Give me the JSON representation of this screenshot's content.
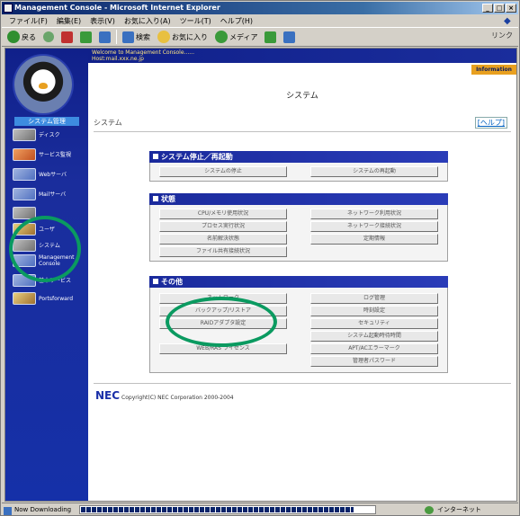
{
  "window": {
    "title": "Management Console - Microsoft Internet Explorer",
    "controls": [
      "_",
      "□",
      "×"
    ]
  },
  "menubar": {
    "items": [
      "ファイル(F)",
      "編集(E)",
      "表示(V)",
      "お気に入り(A)",
      "ツール(T)",
      "ヘルプ(H)"
    ]
  },
  "toolbar": {
    "back": "戻る",
    "search": "検索",
    "favorites": "お気に入り",
    "media": "メディア",
    "links": "リンク"
  },
  "sidebar": {
    "active_label": "システム管理",
    "items": [
      {
        "label": "ディスク",
        "icon": "disk-icon"
      },
      {
        "label": "サービス監視",
        "icon": "service-icon"
      },
      {
        "label": "Webサーバ",
        "icon": "web-server-icon"
      },
      {
        "label": "Mailサーバ",
        "icon": "mail-server-icon"
      },
      {
        "label": "",
        "icon": "dns-icon"
      },
      {
        "label": "ユーザ",
        "icon": "user-icon"
      },
      {
        "label": "システム",
        "icon": "system-icon"
      },
      {
        "label": "Management Console",
        "icon": "management-console-icon"
      },
      {
        "label": "基本サービス",
        "icon": "basic-service-icon"
      },
      {
        "label": "Portsforward",
        "icon": "portsforward-icon"
      }
    ]
  },
  "header": {
    "welcome": "Welcome to Management Console......",
    "host": "Host:mail.xxx.ne.jp",
    "info_badge": "Information"
  },
  "page": {
    "heading": "システム",
    "crumb": "システム",
    "help": "[ヘルプ]"
  },
  "sections": {
    "stop_restart": {
      "title": "システム停止／再起動",
      "buttons": [
        "システムの停止",
        "システムの再起動"
      ]
    },
    "status": {
      "title": "状態",
      "buttons": [
        "CPU/メモリ使用状況",
        "ネットワーク利用状況",
        "プロセス実行状況",
        "ネットワーク接続状況",
        "名前解決状態",
        "定期情報",
        "ファイル共有接続状況"
      ]
    },
    "other": {
      "title": "その他",
      "buttons": [
        "ネットワーク",
        "ログ管理",
        "バックアップ/リストア",
        "時刻設定",
        "RAIDアダプタ設定",
        "セキュリティ",
        "",
        "システム起動時待時間",
        "WEB/RAS ライセンス",
        "APT/ACエラーマーク",
        "",
        "管理者パスワード"
      ]
    }
  },
  "footer": {
    "logo": "NEC",
    "copyright": "Copyright(C) NEC Corporation 2000-2004"
  },
  "statusbar": {
    "text": "Now Downloading",
    "progress": 0.93,
    "zone": "インターネット"
  },
  "colors": {
    "sidebar_bg": "#10208a",
    "section_header": "#1a2a9c",
    "highlight_circle": "#0a9a60",
    "info_badge": "#e8a020"
  }
}
